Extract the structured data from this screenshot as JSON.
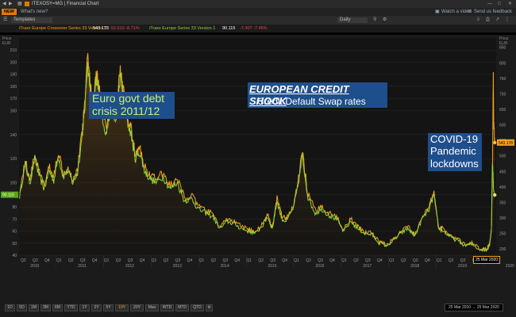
{
  "window": {
    "app_label": "ITEXOSY=MG | Financial Chart",
    "new_badge": "NEW",
    "whats_new": "What's new?",
    "watch_video": "Watch a video",
    "feedback": "Send us feedback",
    "templates": "Templates",
    "interval": "Daily"
  },
  "legend": {
    "series1_label": "iTraxx Europe Crossover Series 33 Version 1",
    "series1_value": "543.178",
    "series1_change": "-52.510 -8.71%",
    "series2_label": "iTraxx Europe Series 33 Version 1",
    "series2_value": "90.115",
    "series2_change": "-7.407 -7.45%"
  },
  "annotations": {
    "title_main": "EUROPEAN CREDIT SHOCK",
    "title_sub": "Credit Default Swap rates",
    "euro_crisis": [
      "Euro govt debt",
      "crisis 2011/12"
    ],
    "covid": [
      "COVID-19",
      "Pandemic",
      "lockdowns"
    ]
  },
  "range_buttons": [
    "1D",
    "5D",
    "1M",
    "3M",
    "6M",
    "YTD",
    "1Y",
    "2Y",
    "5Y",
    "10Y",
    "20Y",
    "Max",
    "WTD",
    "MTD",
    "QTD"
  ],
  "date_range": {
    "from": "25 Mar 2010",
    "to": "25 Mar 2020"
  },
  "last_date_label": "25 Mar 2020",
  "chart_data": {
    "type": "line",
    "left_axis": {
      "label": "Price",
      "unit": "EUR",
      "ticks": [
        40,
        50,
        60,
        70,
        80,
        90,
        100,
        120,
        140,
        160,
        170,
        180,
        190,
        200,
        210
      ],
      "range": [
        40,
        220
      ]
    },
    "right_axis": {
      "label": "Price",
      "unit": "EUR",
      "ticks": [
        200,
        250,
        300,
        350,
        400,
        450,
        500,
        550,
        600,
        650,
        700,
        750,
        800,
        850
      ],
      "range": [
        180,
        880
      ]
    },
    "x_axis": {
      "quarters": [
        "Q2",
        "Q3",
        "Q4",
        "Q1",
        "Q2",
        "Q3",
        "Q4",
        "Q1",
        "Q2",
        "Q3",
        "Q4",
        "Q1",
        "Q2",
        "Q3",
        "Q4",
        "Q1",
        "Q2",
        "Q3",
        "Q4",
        "Q1",
        "Q2",
        "Q3",
        "Q4",
        "Q1",
        "Q2",
        "Q3",
        "Q4",
        "Q1",
        "Q2",
        "Q3",
        "Q4",
        "Q1",
        "Q2",
        "Q3",
        "Q4",
        "Q1",
        "Q2",
        "Q3",
        "Q4",
        "Q1"
      ],
      "years": [
        "2010",
        "2011",
        "2012",
        "2013",
        "2014",
        "2015",
        "2016",
        "2017",
        "2018",
        "2019",
        "2020"
      ]
    },
    "series": [
      {
        "name": "iTraxx Europe Series 33 Version 1",
        "axis": "left",
        "color": "#8ed63a",
        "last_value": 90.115,
        "x": [
          2010.23,
          2010.35,
          2010.45,
          2010.55,
          2010.65,
          2010.75,
          2010.85,
          2010.95,
          2011.05,
          2011.15,
          2011.25,
          2011.35,
          2011.45,
          2011.55,
          2011.6,
          2011.66,
          2011.72,
          2011.78,
          2011.84,
          2011.9,
          2011.96,
          2012.05,
          2012.15,
          2012.25,
          2012.35,
          2012.42,
          2012.5,
          2012.58,
          2012.66,
          2012.76,
          2012.86,
          2012.96,
          2013.1,
          2013.25,
          2013.4,
          2013.55,
          2013.7,
          2013.85,
          2014.0,
          2014.15,
          2014.3,
          2014.45,
          2014.6,
          2014.75,
          2014.9,
          2015.05,
          2015.2,
          2015.35,
          2015.45,
          2015.55,
          2015.65,
          2015.75,
          2015.85,
          2016.0,
          2016.1,
          2016.18,
          2016.3,
          2016.45,
          2016.6,
          2016.75,
          2016.9,
          2017.05,
          2017.2,
          2017.35,
          2017.5,
          2017.65,
          2017.8,
          2017.95,
          2018.1,
          2018.25,
          2018.4,
          2018.55,
          2018.7,
          2018.85,
          2018.95,
          2019.05,
          2019.15,
          2019.3,
          2019.45,
          2019.6,
          2019.75,
          2019.9,
          2020.05,
          2020.12,
          2020.16,
          2020.18,
          2020.2,
          2020.21,
          2020.23
        ]
      }
    ]
  }
}
